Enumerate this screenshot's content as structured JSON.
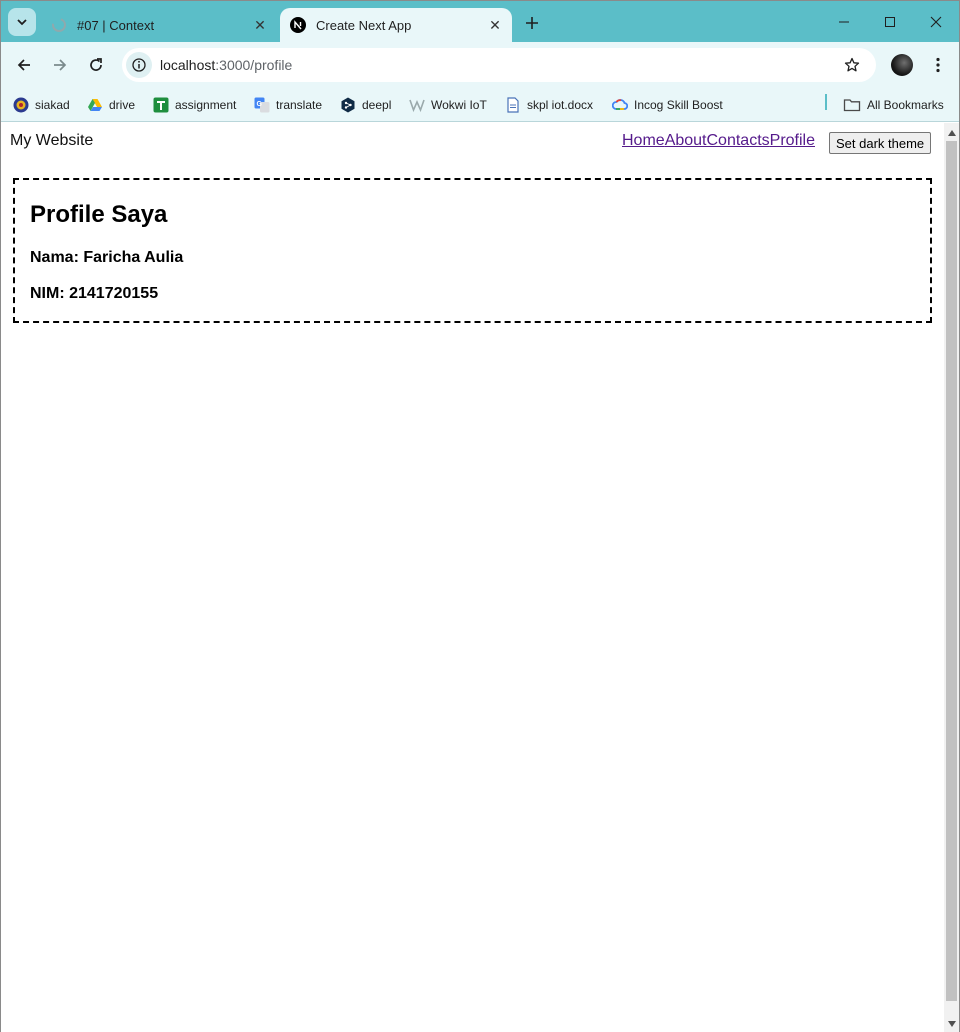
{
  "browser": {
    "tabs": [
      {
        "title": "#07 | Context",
        "active": false,
        "favicon": "spinner-icon"
      },
      {
        "title": "Create Next App",
        "active": true,
        "favicon": "nextjs-icon"
      }
    ],
    "address": {
      "host": "localhost",
      "path": ":3000/profile"
    },
    "bookmarks": [
      {
        "label": "siakad",
        "icon": "university-seal-icon"
      },
      {
        "label": "drive",
        "icon": "google-drive-icon"
      },
      {
        "label": "assignment",
        "icon": "google-classroom-icon"
      },
      {
        "label": "translate",
        "icon": "google-translate-icon"
      },
      {
        "label": "deepl",
        "icon": "deepl-icon"
      },
      {
        "label": "Wokwi IoT",
        "icon": "wokwi-icon"
      },
      {
        "label": "skpl iot.docx",
        "icon": "document-icon"
      },
      {
        "label": "Incog Skill Boost",
        "icon": "google-cloud-icon"
      }
    ],
    "all_bookmarks_label": "All Bookmarks",
    "accent_color": "#5bbec8"
  },
  "page": {
    "brand": "My Website",
    "nav": [
      "Home",
      "About",
      "Contacts",
      "Profile"
    ],
    "theme_button": "Set dark theme",
    "profile": {
      "title": "Profile Saya",
      "nama": "Nama: Faricha Aulia",
      "nim": "NIM: 2141720155"
    }
  }
}
